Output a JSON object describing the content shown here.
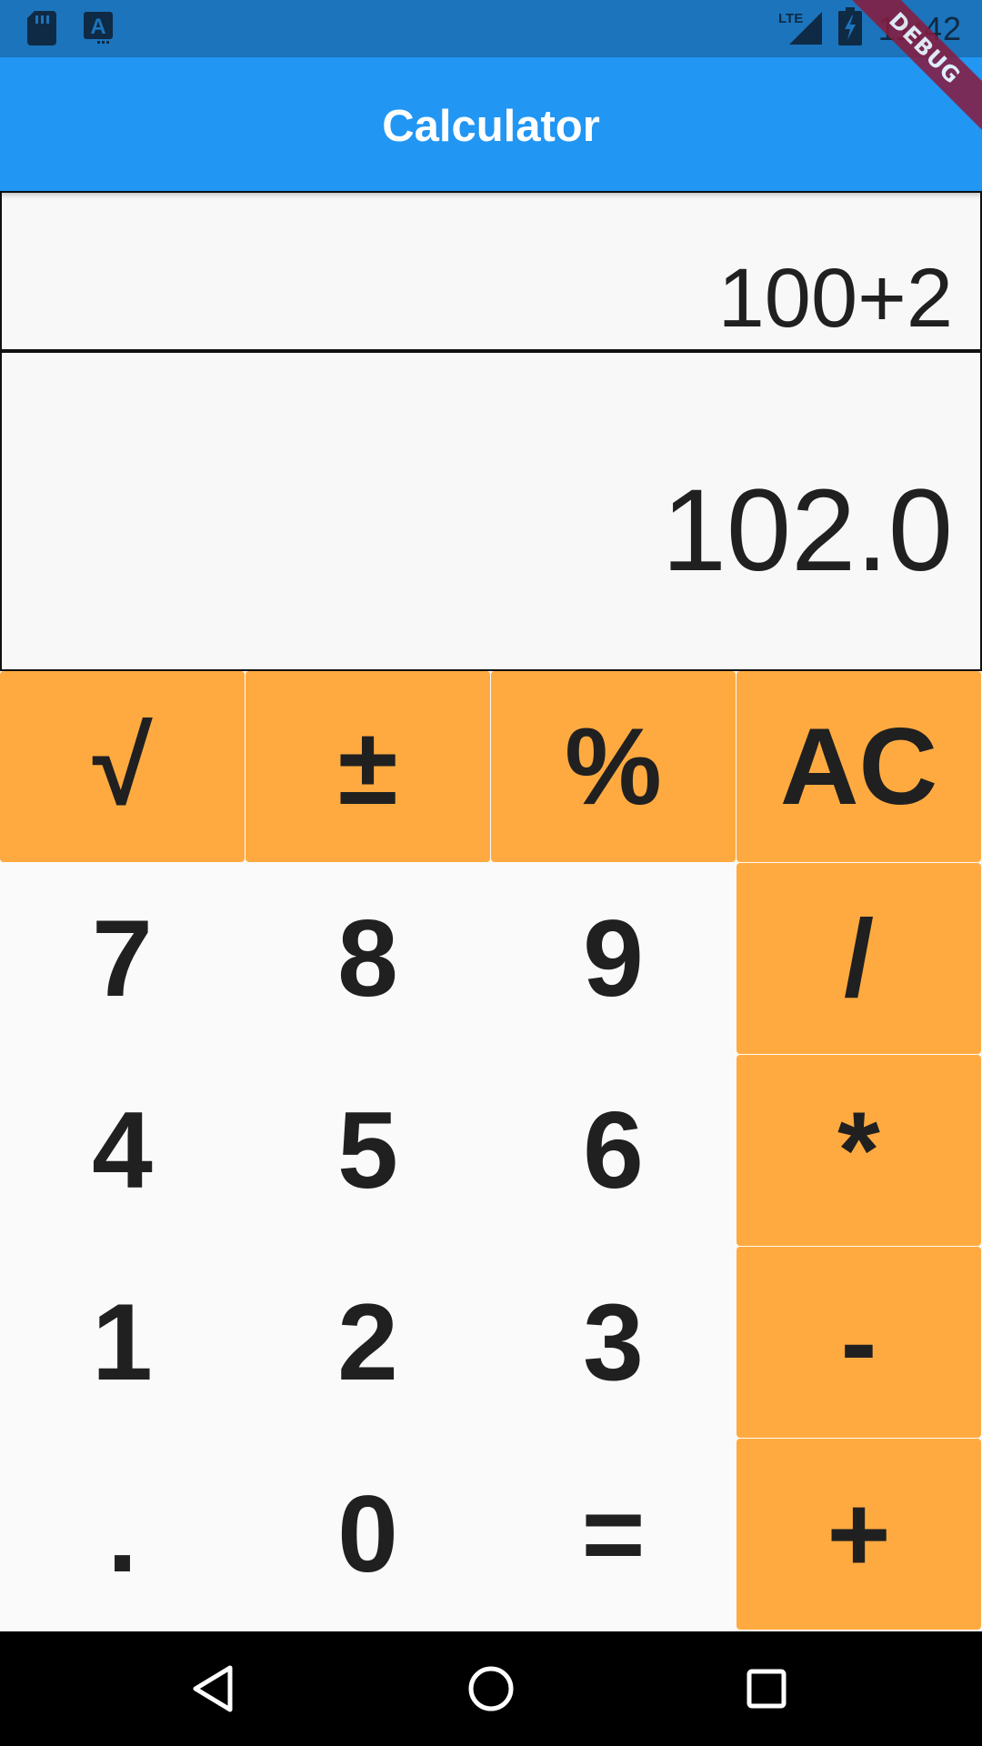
{
  "status_bar": {
    "time": "11:42",
    "network": "LTE",
    "icons": [
      "sd-card-icon",
      "keyboard-a-icon",
      "lte-signal-icon",
      "battery-charging-icon"
    ]
  },
  "debug_banner": "DEBUG",
  "app_bar": {
    "title": "Calculator",
    "color": "#2196F3"
  },
  "display": {
    "expression": "100+2",
    "result": "102.0"
  },
  "keypad": {
    "accent_color": "#FFAA40",
    "rows": [
      [
        "√",
        "±",
        "%",
        "AC"
      ],
      [
        "7",
        "8",
        "9",
        "/"
      ],
      [
        "4",
        "5",
        "6",
        "*"
      ],
      [
        "1",
        "2",
        "3",
        "-"
      ],
      [
        ".",
        "0",
        "=",
        "+"
      ]
    ]
  },
  "nav_bar": {
    "buttons": [
      "back-icon",
      "home-icon",
      "recents-icon"
    ]
  }
}
